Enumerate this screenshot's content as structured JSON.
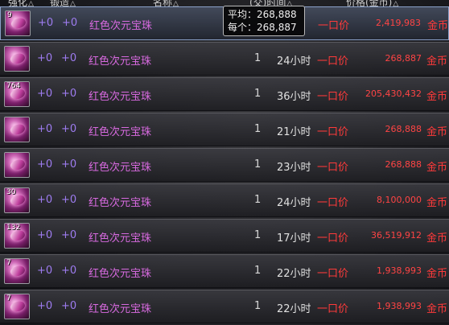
{
  "header": {
    "enhance": "强化",
    "forge": "锻造",
    "name": "名称",
    "time": "(交)时间",
    "price": "价格(金币)",
    "sort_glyph": "△"
  },
  "tooltip": {
    "avg_label": "平均：",
    "avg_value": "268,888",
    "each_label": "每个：",
    "each_value": "268,887"
  },
  "rows": [
    {
      "count": "9",
      "enhance": "+0",
      "forge": "+0",
      "name": "红色次元宝珠",
      "qty": "",
      "time": "",
      "price_type": "一口价",
      "price": "2,419,983",
      "unit": "金币"
    },
    {
      "count": "",
      "enhance": "+0",
      "forge": "+0",
      "name": "红色次元宝珠",
      "qty": "1",
      "time": "24小时",
      "price_type": "一口价",
      "price": "268,887",
      "unit": "金币"
    },
    {
      "count": "764",
      "enhance": "+0",
      "forge": "+0",
      "name": "红色次元宝珠",
      "qty": "1",
      "time": "36小时",
      "price_type": "一口价",
      "price": "205,430,432",
      "unit": "金币"
    },
    {
      "count": "",
      "enhance": "+0",
      "forge": "+0",
      "name": "红色次元宝珠",
      "qty": "1",
      "time": "21小时",
      "price_type": "一口价",
      "price": "268,888",
      "unit": "金币"
    },
    {
      "count": "",
      "enhance": "+0",
      "forge": "+0",
      "name": "红色次元宝珠",
      "qty": "1",
      "time": "23小时",
      "price_type": "一口价",
      "price": "268,888",
      "unit": "金币"
    },
    {
      "count": "30",
      "enhance": "+0",
      "forge": "+0",
      "name": "红色次元宝珠",
      "qty": "1",
      "time": "24小时",
      "price_type": "一口价",
      "price": "8,100,000",
      "unit": "金币"
    },
    {
      "count": "132",
      "enhance": "+0",
      "forge": "+0",
      "name": "红色次元宝珠",
      "qty": "1",
      "time": "17小时",
      "price_type": "一口价",
      "price": "36,519,912",
      "unit": "金币"
    },
    {
      "count": "7",
      "enhance": "+0",
      "forge": "+0",
      "name": "红色次元宝珠",
      "qty": "1",
      "time": "22小时",
      "price_type": "一口价",
      "price": "1,938,993",
      "unit": "金币"
    },
    {
      "count": "7",
      "enhance": "+0",
      "forge": "+0",
      "name": "红色次元宝珠",
      "qty": "1",
      "time": "22小时",
      "price_type": "一口价",
      "price": "1,938,993",
      "unit": "金币"
    }
  ],
  "colors": {
    "enhance": "#9e7cf0",
    "item_name": "#d86ae0",
    "price": "#ff4444",
    "selected_border": "#8aa0c8"
  },
  "icon": "pink-dimension-orb-icon"
}
